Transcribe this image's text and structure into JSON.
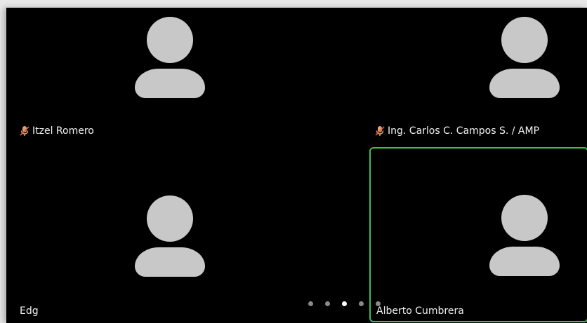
{
  "participants": [
    {
      "name": "Itzel Romero",
      "muted": true
    },
    {
      "name": "Ing. Carlos C. Campos S. / AMP",
      "muted": true
    },
    {
      "name": "Edg",
      "muted": false
    },
    {
      "name": "Alberto Cumbrera",
      "muted": false,
      "active_speaker": true
    }
  ],
  "pagination": {
    "count": 5,
    "active_index": 2
  },
  "icons": {
    "avatar": "person-avatar-icon",
    "mute": "mic-muted-icon"
  },
  "colors": {
    "background": "#000000",
    "avatar": "#c8c8c8",
    "active_border": "#3fbf4a",
    "mute_icon": "#d9a27a",
    "name_text": "#f2f2f2"
  }
}
